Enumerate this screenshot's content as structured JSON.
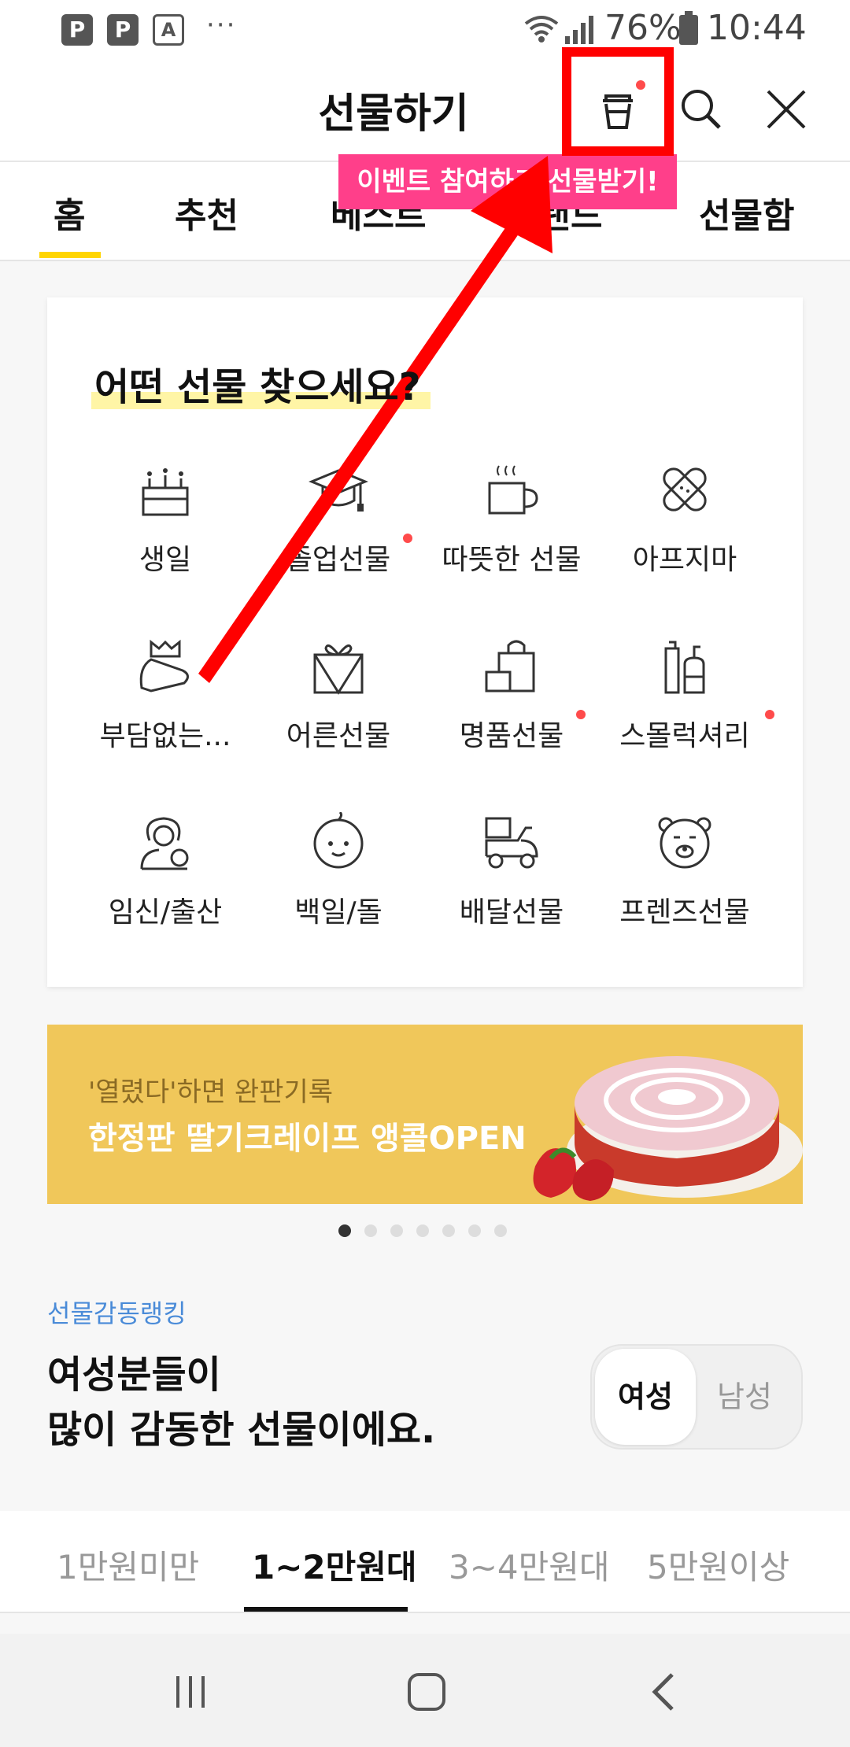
{
  "status_bar": {
    "badges": [
      "P",
      "P",
      "A"
    ],
    "overflow": "···",
    "battery": "76%",
    "time": "10:44"
  },
  "header": {
    "title": "선물하기",
    "icons": [
      "gift-box-icon",
      "search-icon",
      "close-icon"
    ]
  },
  "tooltip": "이벤트 참여하고 선물받기!",
  "tabs": [
    "홈",
    "추천",
    "베스트",
    "브랜드",
    "선물함"
  ],
  "card": {
    "heading": "어떤 선물 찾으세요?",
    "categories": [
      {
        "label": "생일",
        "icon": "birthday-cake-icon"
      },
      {
        "label": "졸업선물",
        "icon": "graduation-cap-icon"
      },
      {
        "label": "따뜻한 선물",
        "icon": "hot-mug-icon"
      },
      {
        "label": "아프지마",
        "icon": "bandage-icon"
      },
      {
        "label": "부담없는...",
        "icon": "gift-hand-icon"
      },
      {
        "label": "어른선물",
        "icon": "wrapped-gift-icon"
      },
      {
        "label": "명품선물",
        "icon": "shopping-bag-icon"
      },
      {
        "label": "스몰럭셔리",
        "icon": "cosmetics-icon"
      },
      {
        "label": "임신/출산",
        "icon": "mother-baby-icon"
      },
      {
        "label": "백일/돌",
        "icon": "baby-face-icon"
      },
      {
        "label": "배달선물",
        "icon": "delivery-scooter-icon"
      },
      {
        "label": "프렌즈선물",
        "icon": "bear-face-icon"
      }
    ]
  },
  "banner": {
    "sub": "'열렸다'하면 완판기록",
    "main": "한정판 딸기크레이프 앵콜OPEN",
    "bg_color": "#f0c75a"
  },
  "pager": {
    "count": 7,
    "active": 0
  },
  "ranking": {
    "kicker": "선물감동랭킹",
    "title_line1": "여성분들이",
    "title_line2": "많이 감동한 선물이에요.",
    "toggle_on": "여성",
    "toggle_off": "남성"
  },
  "price_tabs": [
    "1만원미만",
    "1~2만원대",
    "3~4만원대",
    "5만원이상"
  ],
  "colors": {
    "accent_yellow": "#ffd500",
    "tooltip_pink": "#ff3f8a",
    "annotation_red": "#ff0000",
    "link_blue": "#4a8bd8"
  }
}
